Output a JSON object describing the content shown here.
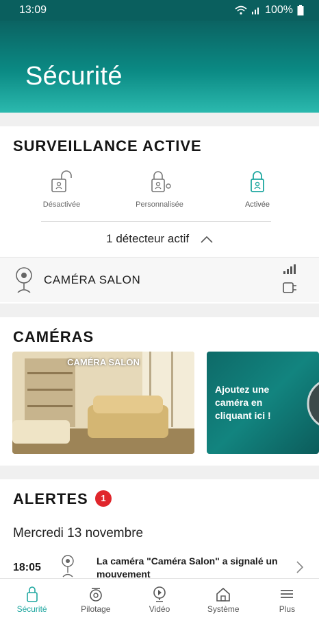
{
  "status_bar": {
    "time": "13:09",
    "battery": "100%"
  },
  "header": {
    "title": "Sécurité"
  },
  "surveillance": {
    "title": "SURVEILLANCE ACTIVE",
    "modes": [
      {
        "label": "Désactivée",
        "icon": "lock-open-icon",
        "selected": false
      },
      {
        "label": "Personnalisée",
        "icon": "lock-custom-icon",
        "selected": false
      },
      {
        "label": "Activée",
        "icon": "lock-closed-icon",
        "selected": true
      }
    ],
    "detector_text": "1 détecteur actif",
    "camera_name": "CAMÉRA SALON"
  },
  "cameras": {
    "title": "CAMÉRAS",
    "thumb_label": "CAMÉRA SALON",
    "add_text": "Ajoutez une caméra en cliquant ici !"
  },
  "alerts": {
    "title": "ALERTES",
    "count": "1",
    "date": "Mercredi 13 novembre",
    "items": [
      {
        "time": "18:05",
        "message": "La caméra \"Caméra Salon\" a signalé un mouvement"
      }
    ]
  },
  "tabs": [
    {
      "label": "Sécurité",
      "icon": "lock-icon",
      "active": true
    },
    {
      "label": "Pilotage",
      "icon": "pilot-icon",
      "active": false
    },
    {
      "label": "Vidéo",
      "icon": "video-icon",
      "active": false
    },
    {
      "label": "Système",
      "icon": "house-icon",
      "active": false
    },
    {
      "label": "Plus",
      "icon": "menu-icon",
      "active": false
    }
  ],
  "colors": {
    "accent": "#1fa7a0",
    "header_dark": "#0b6362",
    "alert_badge": "#e0262c"
  }
}
